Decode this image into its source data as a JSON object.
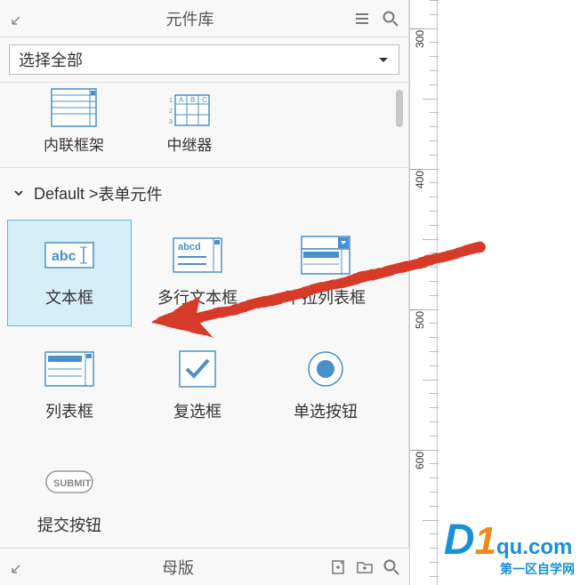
{
  "header": {
    "title": "元件库"
  },
  "select": {
    "label": "选择全部"
  },
  "prev_items": [
    {
      "label": "内联框架"
    },
    {
      "label": "中继器"
    }
  ],
  "section": {
    "prefix": "Default > ",
    "name": "表单元件"
  },
  "widgets": [
    {
      "label": "文本框",
      "selected": true,
      "icon": "textfield"
    },
    {
      "label": "多行文本框",
      "selected": false,
      "icon": "textarea"
    },
    {
      "label": "下拉列表框",
      "selected": false,
      "icon": "dropdown"
    },
    {
      "label": "列表框",
      "selected": false,
      "icon": "listbox"
    },
    {
      "label": "复选框",
      "selected": false,
      "icon": "checkbox"
    },
    {
      "label": "单选按钮",
      "selected": false,
      "icon": "radio"
    },
    {
      "label": "提交按钮",
      "selected": false,
      "icon": "submit"
    }
  ],
  "footer": {
    "title": "母版"
  },
  "ruler_labels": [
    "300",
    "400",
    "500",
    "600"
  ],
  "watermark": {
    "d": "D",
    "one": "1",
    "dom": "qu.com",
    "cn": "第一区自学网"
  }
}
